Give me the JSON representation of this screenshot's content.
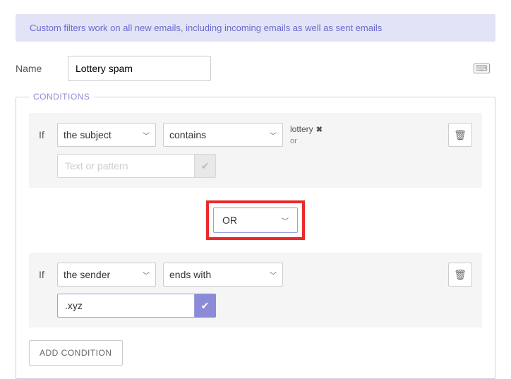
{
  "banner": "Custom filters work on all new emails, including incoming emails as well as sent emails",
  "name": {
    "label": "Name",
    "value": "Lottery spam"
  },
  "conditions": {
    "legend": "CONDITIONS",
    "if_label": "If",
    "pattern_placeholder": "Text or pattern",
    "combinator": "OR",
    "add_button": "ADD CONDITION",
    "items": [
      {
        "field": "the subject",
        "operator": "contains",
        "tags": [
          "lottery"
        ],
        "sub_combinator": "or",
        "input": ""
      },
      {
        "field": "the sender",
        "operator": "ends with",
        "tags": [],
        "input": ".xyz"
      }
    ]
  }
}
